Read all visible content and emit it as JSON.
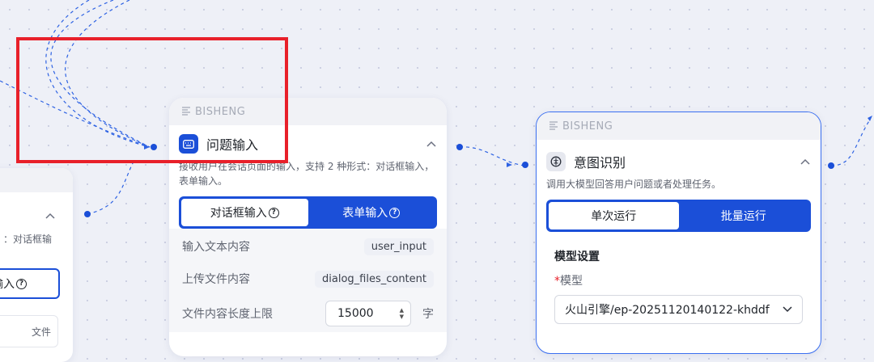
{
  "canvas": {
    "accent": "#1b4fd8",
    "highlight_color": "#e8202a",
    "edge_color": "#2f63e3"
  },
  "left_node": {
    "desc_partial": "：对话框输",
    "input_partial": "输入",
    "file_partial": "文件"
  },
  "input_node": {
    "brand": "BISHENG",
    "title": "问题输入",
    "title_icon": "keyboard-icon",
    "description": "接收用户在会话页面的输入，支持 2 种形式：对话框输入，表单输入。",
    "tabs": [
      {
        "label": "对话框输入",
        "active": true
      },
      {
        "label": "表单输入",
        "active": false
      }
    ],
    "rows": [
      {
        "label": "输入文本内容",
        "value": "user_input"
      },
      {
        "label": "上传文件内容",
        "value": "dialog_files_content"
      }
    ],
    "limit": {
      "label": "文件内容长度上限",
      "value": "15000",
      "unit": "字"
    }
  },
  "intent_node": {
    "brand": "BISHENG",
    "title": "意图识别",
    "title_icon": "brain-icon",
    "description": "调用大模型回答用户问题或者处理任务。",
    "tabs": [
      {
        "label": "单次运行",
        "active": true
      },
      {
        "label": "批量运行",
        "active": false
      }
    ],
    "section_title": "模型设置",
    "model_label": "模型",
    "required_mark": "*",
    "model_value": "火山引擎/ep-20251120140122-khddf"
  }
}
